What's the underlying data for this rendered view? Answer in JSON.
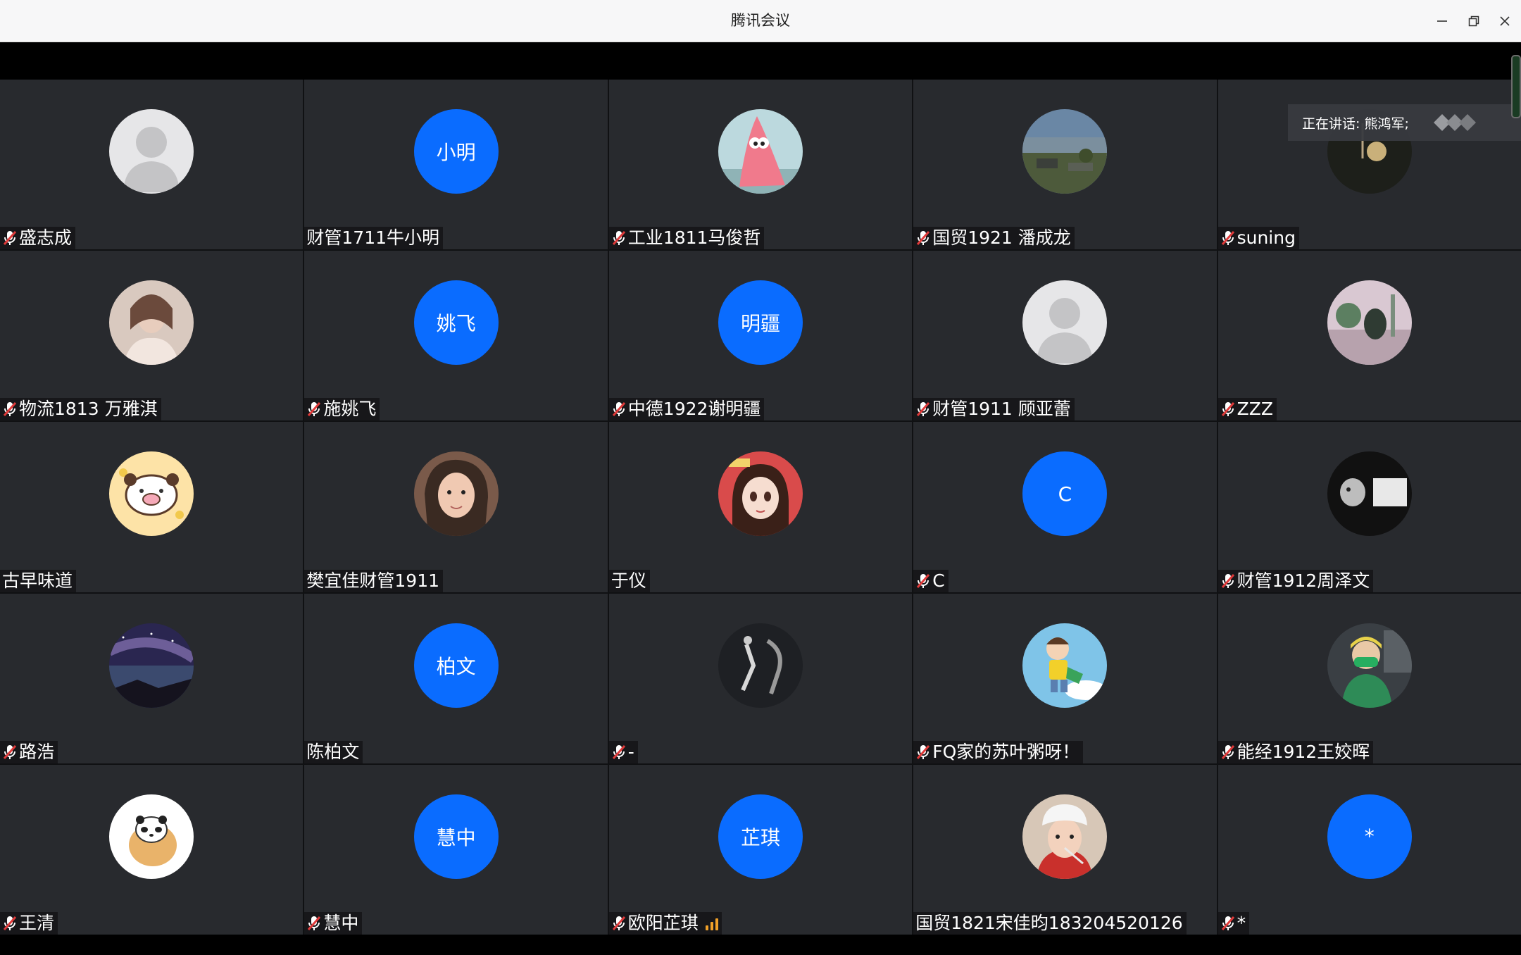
{
  "window": {
    "title": "腾讯会议"
  },
  "speaking": {
    "label": "正在讲话: 熊鸿军;"
  },
  "colors": {
    "accent_blue": "#0a6cff",
    "mic_muted": "#e03a3a",
    "tile_bg": "#282a2e"
  },
  "participants": [
    {
      "name": "盛志成",
      "muted": true,
      "avatar": "default-person",
      "initials": ""
    },
    {
      "name": "财管1711牛小明",
      "muted": false,
      "avatar": "initials",
      "initials": "小明"
    },
    {
      "name": "工业1811马俊哲",
      "muted": true,
      "avatar": "cartoon-starfish",
      "initials": ""
    },
    {
      "name": "国贸1921 潘成龙",
      "muted": true,
      "avatar": "landscape-photo",
      "initials": ""
    },
    {
      "name": "suning",
      "muted": true,
      "avatar": "dark-photo",
      "initials": ""
    },
    {
      "name": "物流1813 万雅淇",
      "muted": true,
      "avatar": "person-photo",
      "initials": ""
    },
    {
      "name": "施姚飞",
      "muted": true,
      "avatar": "initials",
      "initials": "姚飞"
    },
    {
      "name": "中德1922谢明疆",
      "muted": true,
      "avatar": "initials",
      "initials": "明疆"
    },
    {
      "name": "财管1911 顾亚蕾",
      "muted": true,
      "avatar": "default-person",
      "initials": ""
    },
    {
      "name": "ZZZ",
      "muted": true,
      "avatar": "garden-photo",
      "initials": ""
    },
    {
      "name": "古早味道",
      "muted": false,
      "avatar": "cartoon-pig",
      "initials": ""
    },
    {
      "name": "樊宜佳财管1911",
      "muted": false,
      "avatar": "girl-photo",
      "initials": ""
    },
    {
      "name": "于仪",
      "muted": false,
      "avatar": "anime-girl",
      "initials": ""
    },
    {
      "name": "C",
      "muted": true,
      "avatar": "initials",
      "initials": "C"
    },
    {
      "name": "财管1912周泽文",
      "muted": true,
      "avatar": "bw-photo",
      "initials": ""
    },
    {
      "name": "路浩",
      "muted": true,
      "avatar": "galaxy-photo",
      "initials": ""
    },
    {
      "name": "陈柏文",
      "muted": false,
      "avatar": "initials",
      "initials": "柏文"
    },
    {
      "name": "-",
      "muted": true,
      "avatar": "dance-photo",
      "initials": ""
    },
    {
      "name": "FQ家的苏叶粥呀！",
      "muted": true,
      "avatar": "cartoon-boy",
      "initials": ""
    },
    {
      "name": "能经1912王姣晖",
      "muted": true,
      "avatar": "masked-person",
      "initials": ""
    },
    {
      "name": "王清",
      "muted": true,
      "avatar": "cartoon-bread",
      "initials": ""
    },
    {
      "name": "慧中",
      "muted": true,
      "avatar": "initials",
      "initials": "慧中"
    },
    {
      "name": "欧阳芷琪",
      "muted": true,
      "avatar": "initials",
      "initials": "芷琪",
      "signal": true
    },
    {
      "name": "国贸1821宋佳昀183204520126",
      "muted": false,
      "avatar": "chef-girl",
      "initials": ""
    },
    {
      "name": "*",
      "muted": true,
      "avatar": "initials",
      "initials": "*"
    }
  ]
}
